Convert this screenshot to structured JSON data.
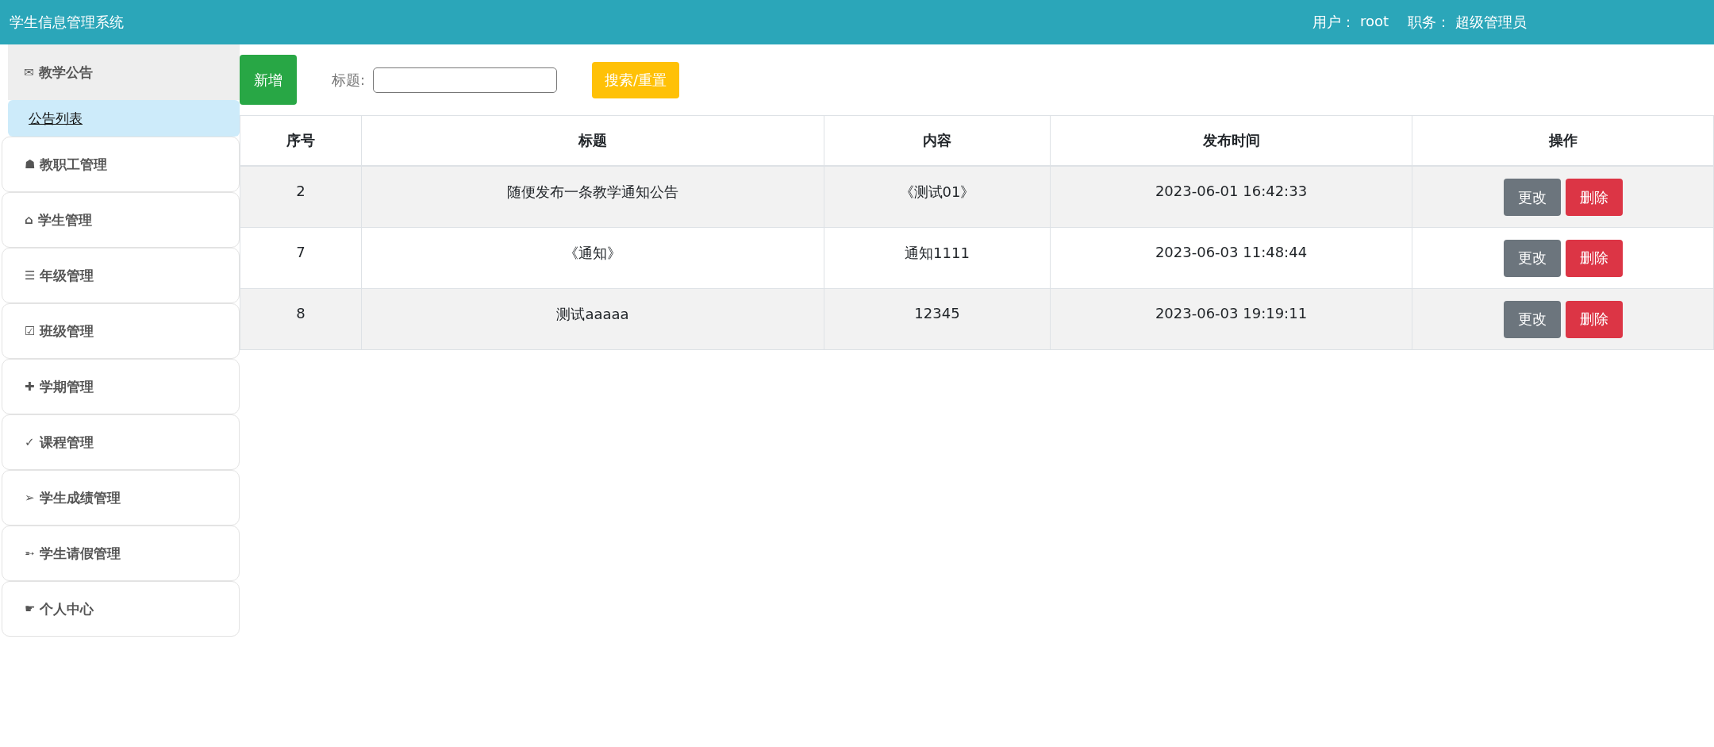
{
  "header": {
    "title": "学生信息管理系统",
    "user_label": "用户：",
    "user": "root",
    "role_label": "职务：",
    "role": "超级管理员"
  },
  "sidebar": {
    "items": [
      {
        "icon": "✉",
        "label": "教学公告",
        "expanded": true,
        "children": [
          {
            "label": "公告列表",
            "selected": true
          }
        ]
      },
      {
        "icon": "☗",
        "label": "教职工管理",
        "expanded": false
      },
      {
        "icon": "⌂",
        "label": "学生管理",
        "expanded": false
      },
      {
        "icon": "☰",
        "label": "年级管理",
        "expanded": false
      },
      {
        "icon": "☑",
        "label": "班级管理",
        "expanded": false
      },
      {
        "icon": "✚",
        "label": "学期管理",
        "expanded": false
      },
      {
        "icon": "✓",
        "label": "课程管理",
        "expanded": false
      },
      {
        "icon": "➢",
        "label": "学生成绩管理",
        "expanded": false
      },
      {
        "icon": "➵",
        "label": "学生请假管理",
        "expanded": false
      },
      {
        "icon": "☛",
        "label": "个人中心",
        "expanded": false
      }
    ]
  },
  "toolbar": {
    "add_button": "新增",
    "title_label": "标题:",
    "search_button": "搜索/重置"
  },
  "table": {
    "columns": [
      "序号",
      "标题",
      "内容",
      "发布时间",
      "操作"
    ],
    "rows": [
      {
        "cells": [
          "2",
          "随便发布一条教学通知公告",
          "《测试01》",
          "2023-06-01 16:42:33"
        ],
        "actions": [
          "更改",
          "删除"
        ]
      },
      {
        "cells": [
          "7",
          "《通知》",
          "通知1111",
          "2023-06-03 11:48:44"
        ],
        "actions": [
          "更改",
          "删除"
        ]
      },
      {
        "cells": [
          "8",
          "测试aaaaa",
          "12345",
          "2023-06-03 19:19:11"
        ],
        "actions": [
          "更改",
          "删除"
        ]
      }
    ]
  }
}
